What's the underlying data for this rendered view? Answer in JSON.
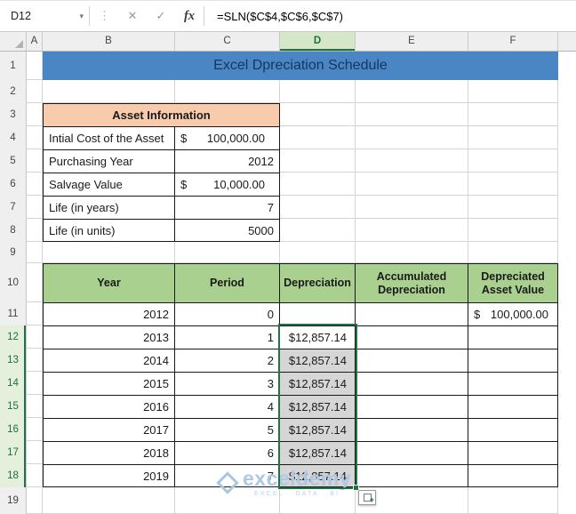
{
  "formula_bar": {
    "name_box": "D12",
    "formula": "=SLN($C$4,$C$6,$C$7)"
  },
  "icons": {
    "name_box_dropdown": "▾",
    "drag_dots": "⋮",
    "cancel": "✕",
    "enter": "✓",
    "insert_function": "fx",
    "autofill_plus": "+"
  },
  "columns": [
    "A",
    "B",
    "C",
    "D",
    "E",
    "F"
  ],
  "rows": [
    "1",
    "2",
    "3",
    "4",
    "5",
    "6",
    "7",
    "8",
    "9",
    "10",
    "11",
    "12",
    "13",
    "14",
    "15",
    "16",
    "17",
    "18",
    "19"
  ],
  "selection": {
    "active_cell": "D12",
    "column": "D",
    "row_start": 12,
    "row_end": 18
  },
  "banner": {
    "title": "Excel Dpreciation Schedule"
  },
  "asset_info": {
    "header": "Asset Information",
    "rows": [
      {
        "label": "Intial Cost of the Asset",
        "currency": "$",
        "value": "100,000.00"
      },
      {
        "label": "Purchasing Year",
        "currency": "",
        "value": "2012"
      },
      {
        "label": "Salvage Value",
        "currency": "$",
        "value": "10,000.00"
      },
      {
        "label": "Life (in years)",
        "currency": "",
        "value": "7"
      },
      {
        "label": "Life (in units)",
        "currency": "",
        "value": "5000"
      }
    ]
  },
  "schedule": {
    "headers": [
      "Year",
      "Period",
      "Depreciation",
      "Accumulated Depreciation",
      "Depreciated Asset Value"
    ],
    "rows": [
      {
        "year": "2012",
        "period": "0",
        "dep": "",
        "acc": "",
        "dav_cur": "$",
        "dav": "100,000.00"
      },
      {
        "year": "2013",
        "period": "1",
        "dep": "$12,857.14",
        "acc": "",
        "dav_cur": "",
        "dav": ""
      },
      {
        "year": "2014",
        "period": "2",
        "dep": "$12,857.14",
        "acc": "",
        "dav_cur": "",
        "dav": ""
      },
      {
        "year": "2015",
        "period": "3",
        "dep": "$12,857.14",
        "acc": "",
        "dav_cur": "",
        "dav": ""
      },
      {
        "year": "2016",
        "period": "4",
        "dep": "$12,857.14",
        "acc": "",
        "dav_cur": "",
        "dav": ""
      },
      {
        "year": "2017",
        "period": "5",
        "dep": "$12,857.14",
        "acc": "",
        "dav_cur": "",
        "dav": ""
      },
      {
        "year": "2018",
        "period": "6",
        "dep": "$12,857.14",
        "acc": "",
        "dav_cur": "",
        "dav": ""
      },
      {
        "year": "2019",
        "period": "7",
        "dep": "$12,857.14",
        "acc": "",
        "dav_cur": "",
        "dav": ""
      }
    ]
  },
  "watermark": {
    "brand": "exceldemy",
    "tagline": "EXCEL · DATA · BI"
  },
  "colors": {
    "banner_bg": "#4a86c4",
    "banner_text": "#17365d",
    "asset_header_bg": "#f8cbad",
    "schedule_header_bg": "#a9d08e",
    "selection_green": "#217346",
    "selection_fill": "#d6d6d6",
    "gridline": "#d4d4d4"
  }
}
